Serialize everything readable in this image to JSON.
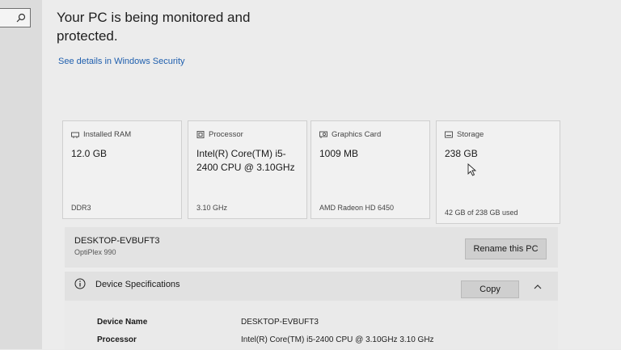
{
  "headline": "Your PC is being monitored and protected.",
  "security_link": "See details in Windows Security",
  "cards": [
    {
      "title": "Installed RAM",
      "value": "12.0 GB",
      "footer": "DDR3",
      "icon": "ram-icon"
    },
    {
      "title": "Processor",
      "value": "Intel(R) Core(TM) i5-2400 CPU @ 3.10GHz",
      "footer": "3.10 GHz",
      "icon": "processor-icon"
    },
    {
      "title": "Graphics Card",
      "value": "1009 MB",
      "footer": "AMD Radeon HD 6450",
      "icon": "graphics-card-icon"
    },
    {
      "title": "Storage",
      "value": "238 GB",
      "footer": "42 GB of 238 GB used",
      "icon": "storage-icon"
    }
  ],
  "pc": {
    "name": "DESKTOP-EVBUFT3",
    "model": "OptiPlex 990",
    "rename_label": "Rename this PC"
  },
  "specs": {
    "title": "Device Specifications",
    "copy_label": "Copy",
    "rows": [
      {
        "key": "Device Name",
        "value": "DESKTOP-EVBUFT3"
      },
      {
        "key": "Processor",
        "value": "Intel(R) Core(TM) i5-2400 CPU @ 3.10GHz   3.10 GHz"
      }
    ]
  }
}
